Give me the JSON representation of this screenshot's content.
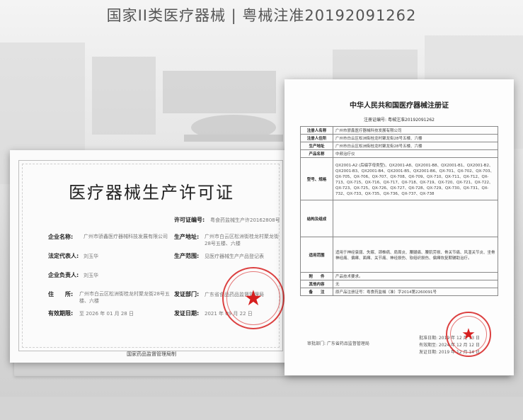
{
  "headline": "国家II类医疗器械 | 粤械注准20192091262",
  "license_cert": {
    "title": "医疗器械生产许可证",
    "permit_no_label": "许可证编号:",
    "permit_no_value": "粤食药监械生产许20162808号",
    "company_label": "企业名称:",
    "company_value": "广州市骄鑫医疗器械科技发展有限公司",
    "address_label": "生产地址:",
    "address_value": "广州市白云区松洲街桂龙村聚龙街28号五楼、六楼",
    "legal_rep_label": "法定代表人:",
    "legal_rep_value": "刘玉华",
    "scope_label": "生产范围:",
    "scope_value": "见医疗器械生产产品登记表",
    "principal_label": "企业负责人:",
    "principal_value": "刘玉华",
    "residence_label": "住　　所:",
    "residence_value": "广州市白云区松洲街桂龙村聚龙街28号五楼、六楼",
    "issuer_label": "发证部门:",
    "issuer_value": "广东省食品药品监督管理局",
    "validity_label": "有效期限:",
    "validity_value": "至 2026 年 01 月 28 日",
    "issue_date_label": "发证日期:",
    "issue_date_value": "2021 年 09 月 22 日",
    "footer": "国家药品监督管理局制",
    "stamp_text": "广东省食品药品监督管理局"
  },
  "registration_cert": {
    "title": "中华人民共和国医疗器械注册证",
    "reg_no": "注册证编号: 粤械注准20192091262",
    "rows": [
      {
        "k": "注册人名称",
        "v": "广州市骄鑫医疗器械科技发展有限公司"
      },
      {
        "k": "注册人住所",
        "v": "广州市白云区松洲街桂龙村聚龙街28号五楼、六楼"
      },
      {
        "k": "生产地址",
        "v": "广州市白云区松洲街桂龙村聚龙街28号五楼、六楼"
      },
      {
        "k": "产品名称",
        "v": "中频治疗仪"
      },
      {
        "k": "型号、规格",
        "v": "QX2001-A2 (后缀字母类型)、QX2001-A8、QX2001-B8、QX2001-B1、QX2001-B2、QX2001-B3、QX2001-B4、QX2001-B5、QX2001-B6、QX-701、QX-702、QX-703、QX-705、QX-706、QX-707、QX-708、QX-709、QX-710、QX-711、QX-712、QX-713、QX-715、QX-716、QX-717、QX-718、QX-719、QX-720、QX-721、QX-722、QX-723、QX-725、QX-726、QX-727、QX-728、QX-729、QX-730、QX-731、QX-732、QX-733、QX-735、QX-736、QX-737、QX-738"
      },
      {
        "k": "结构及组成",
        "v": ""
      },
      {
        "k": "适用范围",
        "v": "适用于神经衰弱、失眠、颈椎病、肩周炎、腰腿痛、腰肌劳损、骨关节痛、风湿关节炎、坐骨神经痛、偏瘫、面瘫、关节痛、神经损伤、软组织损伤、偏瘫恢复期辅助治疗。"
      },
      {
        "k": "附　　件",
        "v": "产品技术要求。"
      },
      {
        "k": "其他内容",
        "v": "无"
      },
      {
        "k": "备　　注",
        "v": "原产品注册证号：粤食药监械（准）字2014第2260091号"
      }
    ],
    "approval_dept": "审批部门: 广东省药品监督管理局",
    "approval_date": "批准日期: 2019 年 12 月 13 日",
    "valid_until": "有效期至: 2024 年 12 月 12 日",
    "issue_date": "发证日期: 2019 年 12 月 14 日",
    "stamp_text": "广东省药品监督管理局"
  },
  "colors": {
    "stamp": "#d61e1e",
    "frame_bg": "#fbfbfb"
  }
}
